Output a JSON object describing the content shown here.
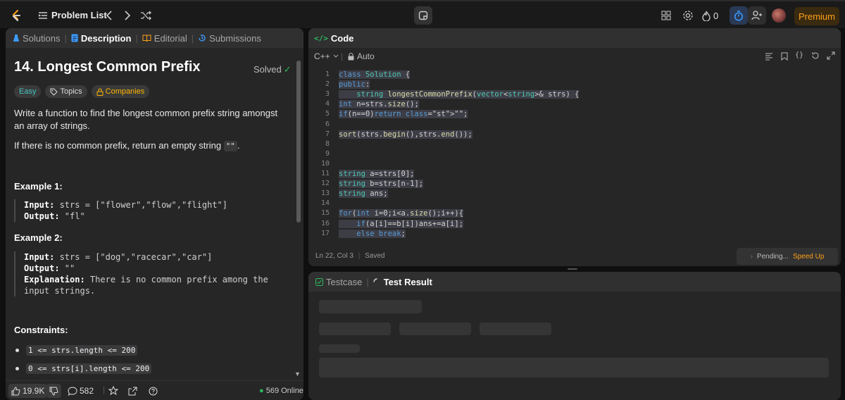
{
  "topbar": {
    "problem_list": "Problem List",
    "streak_count": "0",
    "premium": "Premium"
  },
  "left_tabs": {
    "solutions": "Solutions",
    "description": "Description",
    "editorial": "Editorial",
    "submissions": "Submissions"
  },
  "problem": {
    "title": "14. Longest Common Prefix",
    "solved": "Solved",
    "difficulty": "Easy",
    "topics": "Topics",
    "companies": "Companies",
    "desc_1": "Write a function to find the longest common prefix string amongst an array of strings.",
    "desc_2a": "If there is no common prefix, return an empty string ",
    "desc_2_code": "\"\"",
    "desc_2b": ".",
    "example1_title": "Example 1:",
    "example1_input_label": "Input:",
    "example1_input": " strs = [\"flower\",\"flow\",\"flight\"]",
    "example1_output_label": "Output:",
    "example1_output": " \"fl\"",
    "example2_title": "Example 2:",
    "example2_input_label": "Input:",
    "example2_input": " strs = [\"dog\",\"racecar\",\"car\"]",
    "example2_output_label": "Output:",
    "example2_output": " \"\"",
    "example2_expl_label": "Explanation:",
    "example2_expl": " There is no common prefix among the input strings.",
    "constraints_title": "Constraints:",
    "constraint_1": "1 <= strs.length <= 200",
    "constraint_2": "0 <= strs[i].length <= 200"
  },
  "left_footer": {
    "likes": "19.9K",
    "comments": "582",
    "online": "569 Online"
  },
  "code_panel": {
    "title": "Code",
    "language": "C++",
    "mode": "Auto",
    "status_pos": "Ln 22, Col 3",
    "status_saved": "Saved",
    "pending": "Pending...",
    "speed_up": "Speed Up"
  },
  "code_lines": [
    {
      "n": "1",
      "t": "class Solution {"
    },
    {
      "n": "2",
      "t": "public:"
    },
    {
      "n": "3",
      "t": "    string longestCommonPrefix(vector<string>& strs) {"
    },
    {
      "n": "4",
      "t": "int n=strs.size();"
    },
    {
      "n": "5",
      "t": "if(n==0)return \"\";"
    },
    {
      "n": "6",
      "t": ""
    },
    {
      "n": "7",
      "t": "sort(strs.begin(),strs.end());"
    },
    {
      "n": "8",
      "t": ""
    },
    {
      "n": "9",
      "t": ""
    },
    {
      "n": "10",
      "t": ""
    },
    {
      "n": "11",
      "t": "string a=strs[0];"
    },
    {
      "n": "12",
      "t": "string b=strs[n-1];"
    },
    {
      "n": "13",
      "t": "string ans;"
    },
    {
      "n": "14",
      "t": ""
    },
    {
      "n": "15",
      "t": "for(int i=0;i<a.size();i++){"
    },
    {
      "n": "16",
      "t": "    if(a[i]==b[i])ans+=a[i];"
    },
    {
      "n": "17",
      "t": "    else break;"
    }
  ],
  "test_panel": {
    "testcase": "Testcase",
    "test_result": "Test Result"
  },
  "colors": {
    "accent": "#ffa116",
    "easy": "#46c6c2",
    "solved": "#2cbb5d"
  }
}
